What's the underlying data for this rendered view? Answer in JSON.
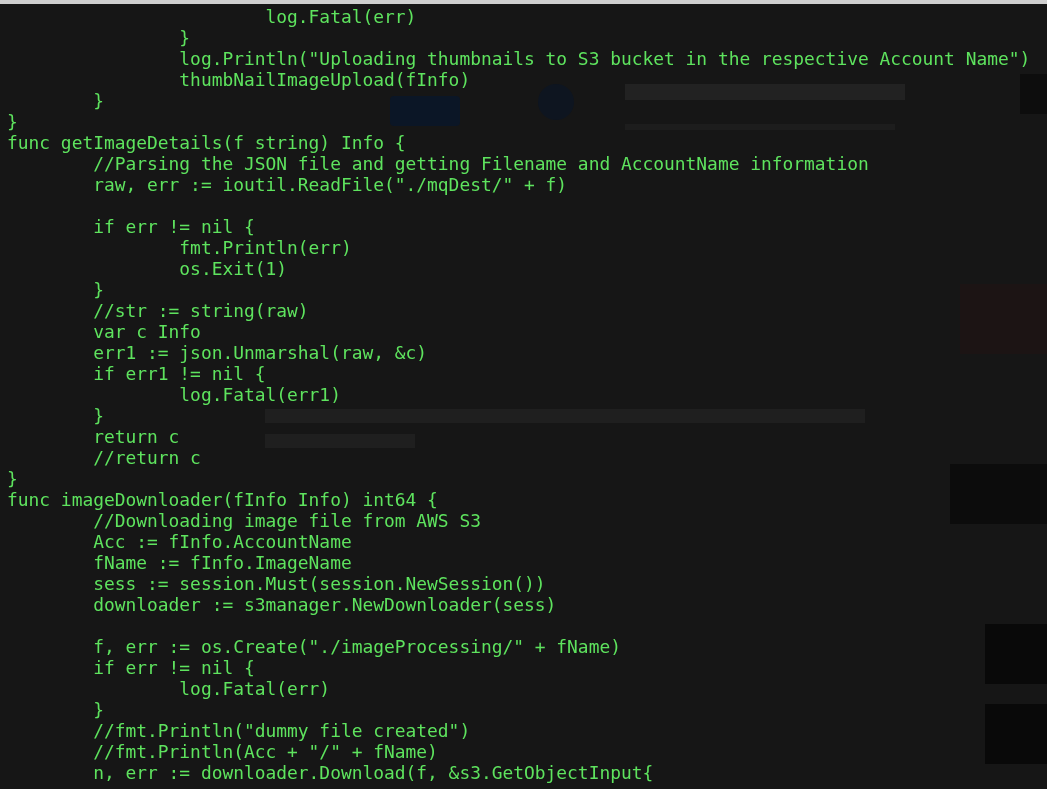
{
  "terminal": {
    "lines": [
      {
        "kind": "code",
        "text": "\t\t\tlog.Fatal(err)"
      },
      {
        "kind": "code",
        "text": "\t\t}"
      },
      {
        "kind": "code",
        "text": "\t\tlog.Println(\"Uploading thumbnails to S3 bucket in the respective Account Name\")"
      },
      {
        "kind": "code",
        "text": "\t\tthumbNailImageUpload(fInfo)"
      },
      {
        "kind": "code",
        "text": "\t}"
      },
      {
        "kind": "code",
        "text": "}"
      },
      {
        "kind": "code",
        "text": "func getImageDetails(f string) Info {"
      },
      {
        "kind": "code",
        "text": "\t//Parsing the JSON file and getting Filename and AccountName information"
      },
      {
        "kind": "code",
        "text": "\traw, err := ioutil.ReadFile(\"./mqDest/\" + f)"
      },
      {
        "kind": "blank"
      },
      {
        "kind": "code",
        "text": "\tif err != nil {"
      },
      {
        "kind": "code",
        "text": "\t\tfmt.Println(err)"
      },
      {
        "kind": "code",
        "text": "\t\tos.Exit(1)"
      },
      {
        "kind": "code",
        "text": "\t}"
      },
      {
        "kind": "code",
        "text": "\t//str := string(raw)"
      },
      {
        "kind": "code",
        "text": "\tvar c Info"
      },
      {
        "kind": "code",
        "text": "\terr1 := json.Unmarshal(raw, &c)"
      },
      {
        "kind": "code",
        "text": "\tif err1 != nil {"
      },
      {
        "kind": "code",
        "text": "\t\tlog.Fatal(err1)"
      },
      {
        "kind": "code",
        "text": "\t}"
      },
      {
        "kind": "code",
        "text": "\treturn c"
      },
      {
        "kind": "code",
        "text": "\t//return c"
      },
      {
        "kind": "code",
        "text": "}"
      },
      {
        "kind": "code",
        "text": "func imageDownloader(fInfo Info) int64 {"
      },
      {
        "kind": "code",
        "text": "\t//Downloading image file from AWS S3"
      },
      {
        "kind": "code",
        "text": "\tAcc := fInfo.AccountName"
      },
      {
        "kind": "code",
        "text": "\tfName := fInfo.ImageName"
      },
      {
        "kind": "code",
        "text": "\tsess := session.Must(session.NewSession())"
      },
      {
        "kind": "code",
        "text": "\tdownloader := s3manager.NewDownloader(sess)"
      },
      {
        "kind": "blank"
      },
      {
        "kind": "code",
        "text": "\tf, err := os.Create(\"./imageProcessing/\" + fName)"
      },
      {
        "kind": "code",
        "text": "\tif err != nil {"
      },
      {
        "kind": "code",
        "text": "\t\tlog.Fatal(err)"
      },
      {
        "kind": "code",
        "text": "\t}"
      },
      {
        "kind": "code",
        "text": "\t//fmt.Println(\"dummy file created\")"
      },
      {
        "kind": "code",
        "text": "\t//fmt.Println(Acc + \"/\" + fName)"
      },
      {
        "kind": "code",
        "text": "\tn, err := downloader.Download(f, &s3.GetObjectInput{"
      }
    ]
  }
}
